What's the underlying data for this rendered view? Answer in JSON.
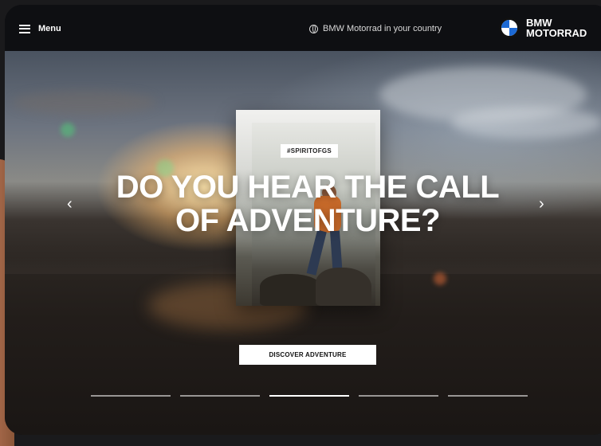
{
  "header": {
    "menu_label": "Menu",
    "country_label": "BMW Motorrad in your country",
    "brand_line1": "BMW",
    "brand_line2": "MOTORRAD"
  },
  "hero": {
    "tag": "#SPIRITOFGS",
    "headline_line1": "DO YOU HEAR THE CALL",
    "headline_line2": "OF ADVENTURE?",
    "cta_label": "DISCOVER ADVENTURE",
    "prev_arrow": "‹",
    "next_arrow": "›"
  },
  "carousel": {
    "slides": 5,
    "active_index": 2
  },
  "colors": {
    "header_bg": "#0e0f12",
    "cta_bg": "#ffffff",
    "bmw_blue": "#1c69d4"
  },
  "icons": [
    "menu-icon",
    "globe-icon",
    "bmw-roundel-icon",
    "chevron-left-icon",
    "chevron-right-icon"
  ]
}
